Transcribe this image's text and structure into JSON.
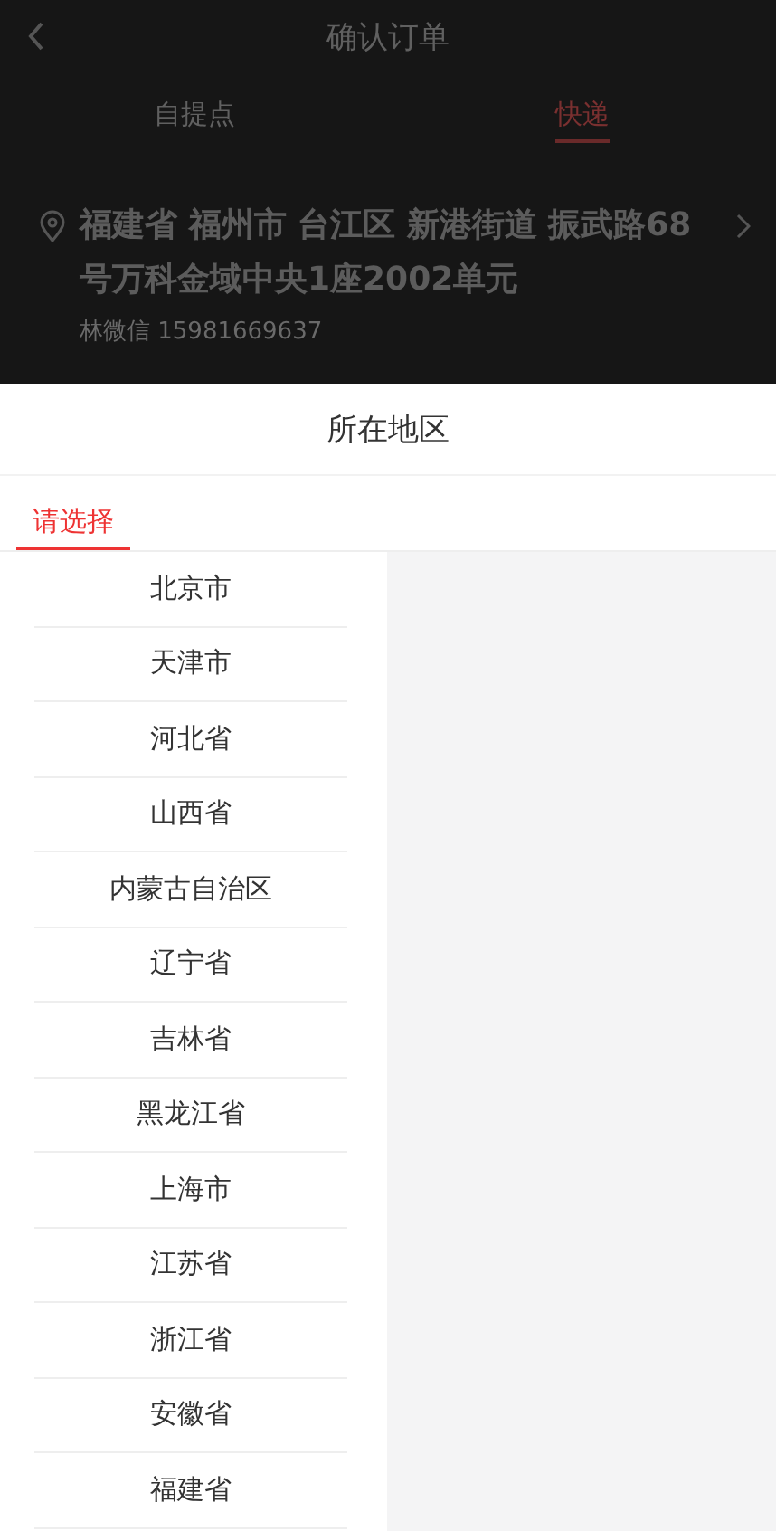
{
  "page": {
    "title": "确认订单",
    "tabs": [
      {
        "label": "自提点",
        "selected": false
      },
      {
        "label": "快递",
        "selected": true
      }
    ],
    "address": "福建省 福州市 台江区 新港街道 振武路68号万科金域中央1座2002单元",
    "contact": "林微信 15981669637"
  },
  "sheet": {
    "title": "所在地区",
    "tabs": [
      {
        "label": "请选择",
        "selected": true
      }
    ],
    "regions": [
      {
        "name": "北京市",
        "selected": false
      },
      {
        "name": "天津市",
        "selected": false
      },
      {
        "name": "河北省",
        "selected": false
      },
      {
        "name": "山西省",
        "selected": false
      },
      {
        "name": "内蒙古自治区",
        "selected": false
      },
      {
        "name": "辽宁省",
        "selected": false
      },
      {
        "name": "吉林省",
        "selected": false
      },
      {
        "name": "黑龙江省",
        "selected": false
      },
      {
        "name": "上海市",
        "selected": false
      },
      {
        "name": "江苏省",
        "selected": false
      },
      {
        "name": "浙江省",
        "selected": false
      },
      {
        "name": "安徽省",
        "selected": false
      },
      {
        "name": "福建省",
        "selected": false
      }
    ]
  }
}
